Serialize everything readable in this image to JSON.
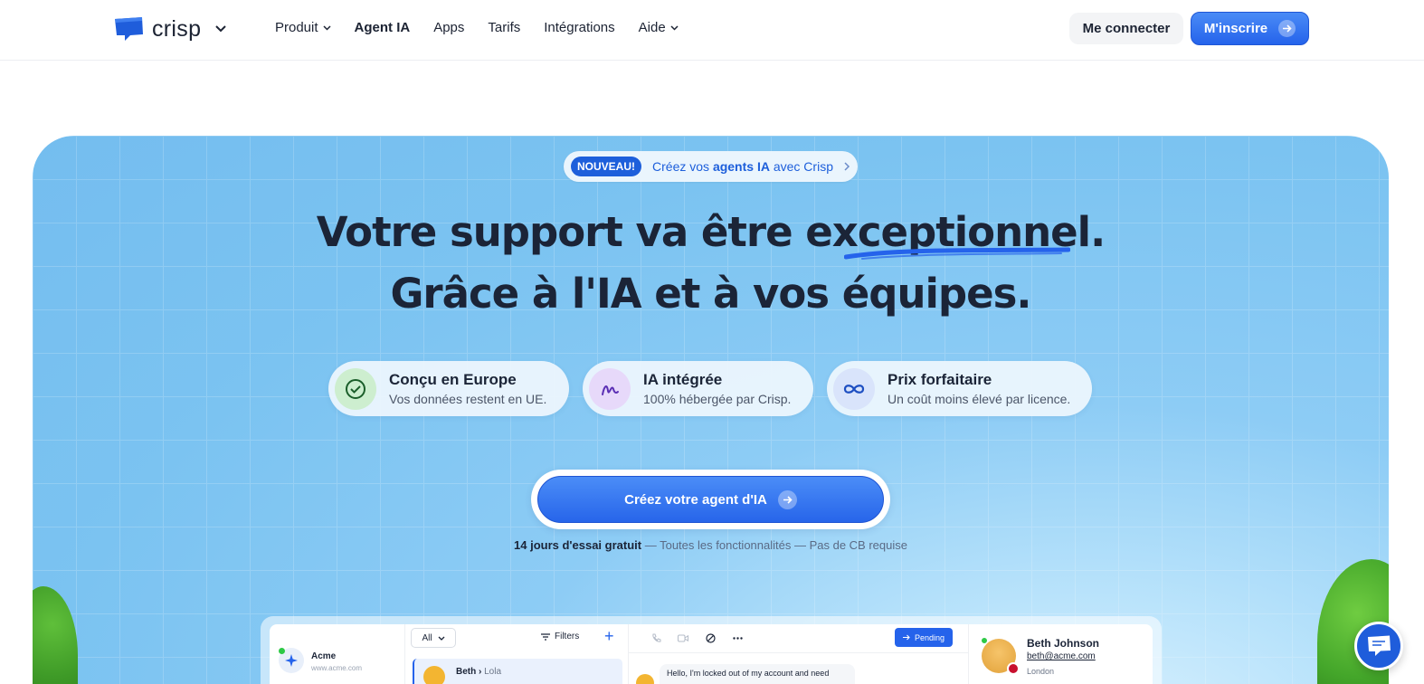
{
  "header": {
    "brand": "crisp",
    "nav": [
      {
        "label": "Produit",
        "dropdown": true
      },
      {
        "label": "Agent IA",
        "dropdown": false,
        "active": true
      },
      {
        "label": "Apps",
        "dropdown": false
      },
      {
        "label": "Tarifs",
        "dropdown": false
      },
      {
        "label": "Intégrations",
        "dropdown": false
      },
      {
        "label": "Aide",
        "dropdown": true
      }
    ],
    "login_label": "Me connecter",
    "signup_label": "M'inscrire"
  },
  "hero": {
    "badge_tag": "NOUVEAU!",
    "badge_text_pre": "Créez vos ",
    "badge_text_bold": "agents IA",
    "badge_text_post": " avec Crisp",
    "headline_line1": "Votre support va être exceptionnel.",
    "headline_line2": "Grâce à l'IA et à vos équipes.",
    "features": [
      {
        "title": "Conçu en Europe",
        "subtitle": "Vos données restent en UE.",
        "icon": "check-circle-icon",
        "icon_color": "#2f8f3c",
        "icon_bg": "#cdeecf"
      },
      {
        "title": "IA intégrée",
        "subtitle": "100% hébergée par Crisp.",
        "icon": "scribble-icon",
        "icon_color": "#6b3fc7",
        "icon_bg": "#e7d9fa"
      },
      {
        "title": "Prix forfaitaire",
        "subtitle": "Un coût moins élevé par licence.",
        "icon": "infinity-icon",
        "icon_color": "#1d4fc2",
        "icon_bg": "#d9e4fb"
      }
    ],
    "cta_label": "Créez votre agent d'IA",
    "trial_bold": "14 jours d'essai gratuit",
    "trial_rest": " — Toutes les fonctionnalités — Pas de CB requise"
  },
  "preview": {
    "workspace_name": "Acme",
    "workspace_url": "www.acme.com",
    "filter_select": "All",
    "filters_label": "Filters",
    "conversation": {
      "from": "Beth",
      "to": "Lola"
    },
    "pending_label": "Pending",
    "message": "Hello, I'm locked out of my account and need",
    "profile": {
      "name": "Beth Johnson",
      "email": "beth@acme.com",
      "city": "London"
    }
  },
  "colors": {
    "primary": "#2563eb",
    "text_dark": "#1b2437",
    "hero_sky": "#7bc3f1"
  }
}
